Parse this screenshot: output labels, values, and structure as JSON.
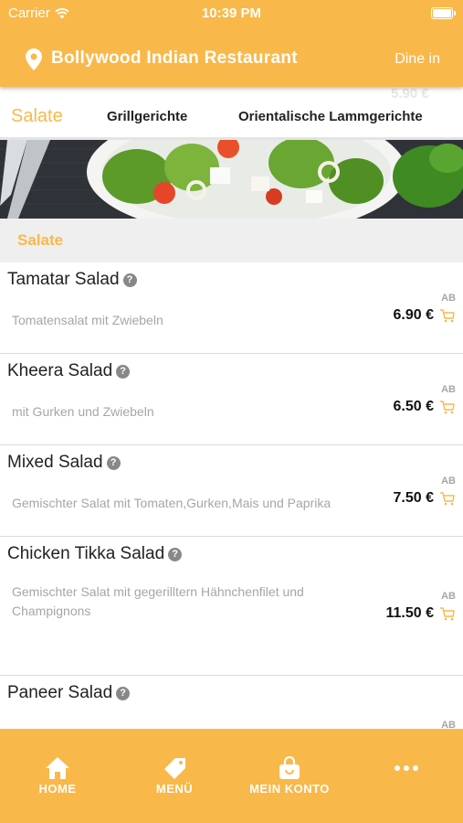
{
  "status_bar": {
    "carrier": "Carrier",
    "time": "10:39 PM"
  },
  "header": {
    "restaurant_name": "Bollywood Indian Restaurant",
    "order_mode": "Dine in"
  },
  "category_tabs": [
    {
      "label": "Salate",
      "active": true
    },
    {
      "label": "Grillgerichte",
      "active": false
    },
    {
      "label": "Orientalische Lammgerichte",
      "active": false
    }
  ],
  "ghost_price": "5.90 €",
  "banner": {
    "icon": "salad-photo"
  },
  "section": {
    "title": "Salate"
  },
  "items": [
    {
      "name": "Tamatar Salad",
      "description": "Tomatensalat mit Zwiebeln",
      "price_prefix": "AB",
      "price": "6.90 €"
    },
    {
      "name": "Kheera Salad",
      "description": "mit Gurken und Zwiebeln",
      "price_prefix": "AB",
      "price": "6.50 €"
    },
    {
      "name": "Mixed Salad",
      "description": "Gemischter Salat mit Tomaten,Gurken,Mais und Paprika",
      "price_prefix": "AB",
      "price": "7.50 €"
    },
    {
      "name": "Chicken Tikka Salad",
      "description": "Gemischter Salat mit gegerilltern Hähnchenfilet und Champignons",
      "price_prefix": "AB",
      "price": "11.50 €"
    },
    {
      "name": "Paneer Salad",
      "description": "",
      "price_prefix": "AB",
      "price": ""
    }
  ],
  "bottom_tabs": [
    {
      "label": "HOME",
      "icon": "home-icon"
    },
    {
      "label": "MENÜ",
      "icon": "tag-icon"
    },
    {
      "label": "MEIN KONTO",
      "icon": "bag-icon"
    },
    {
      "label": "",
      "icon": "more-icon"
    }
  ],
  "colors": {
    "accent": "#f9b84a",
    "price_text": "#111111",
    "muted_text": "#a6a6a6"
  }
}
